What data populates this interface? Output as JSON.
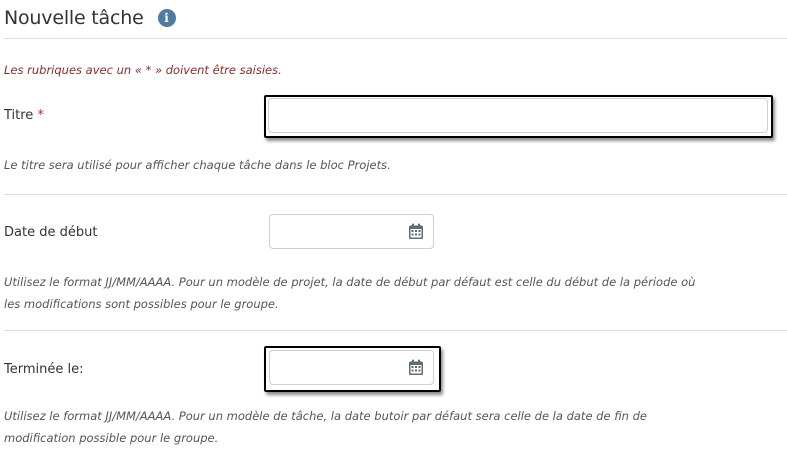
{
  "header": {
    "title": "Nouvelle tâche",
    "info_icon": "info-icon",
    "info_glyph": "i"
  },
  "required_note": "Les rubriques avec un « * » doivent être saisies.",
  "fields": {
    "title": {
      "label": "Titre",
      "required_marker": "*",
      "value": "",
      "help": "Le titre sera utilisé pour afficher chaque tâche dans le bloc Projets."
    },
    "start_date": {
      "label": "Date de début",
      "value": "",
      "icon": "calendar-icon",
      "help_line1": "Utilisez le format JJ/MM/AAAA. Pour un modèle de projet, la date de début par défaut est celle du début de la période où",
      "help_line2": "les modifications sont possibles pour le groupe."
    },
    "completed_on": {
      "label": "Terminée le:",
      "value": "",
      "icon": "calendar-icon",
      "help_line1": "Utilisez le format JJ/MM/AAAA. Pour un modèle de tâche, la date butoir par défaut sera celle de la date de fin de",
      "help_line2": "modification possible pour le groupe."
    }
  },
  "colors": {
    "info_icon": "#4f7ba0",
    "required_note": "#8b2c2c",
    "required_star": "#b03030",
    "calendar_icon": "#5f6b73",
    "divider": "#dcdcdc"
  }
}
